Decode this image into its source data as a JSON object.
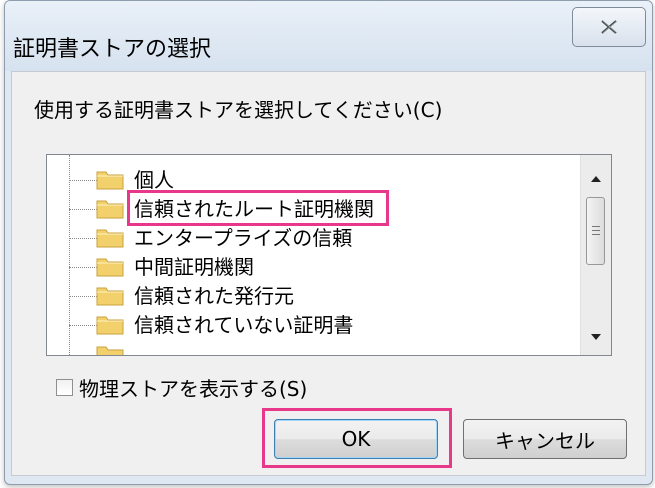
{
  "dialog": {
    "title": "証明書ストアの選択",
    "close_icon": "close-x-icon"
  },
  "prompt": "使用する証明書ストアを選択してください(C)",
  "tree": {
    "items": [
      {
        "label": "個人",
        "icon": "folder-icon"
      },
      {
        "label": "信頼されたルート証明機関",
        "icon": "folder-icon",
        "highlighted": true
      },
      {
        "label": "エンタープライズの信頼",
        "icon": "folder-icon"
      },
      {
        "label": "中間証明機関",
        "icon": "folder-icon"
      },
      {
        "label": "信頼された発行元",
        "icon": "folder-icon"
      },
      {
        "label": "信頼されていない証明書",
        "icon": "folder-icon"
      }
    ]
  },
  "checkbox": {
    "label": "物理ストアを表示する(S)",
    "checked": false
  },
  "buttons": {
    "ok": "OK",
    "cancel": "キャンセル"
  },
  "colors": {
    "highlight": "#e8388a",
    "folder": "#f2d06b"
  }
}
